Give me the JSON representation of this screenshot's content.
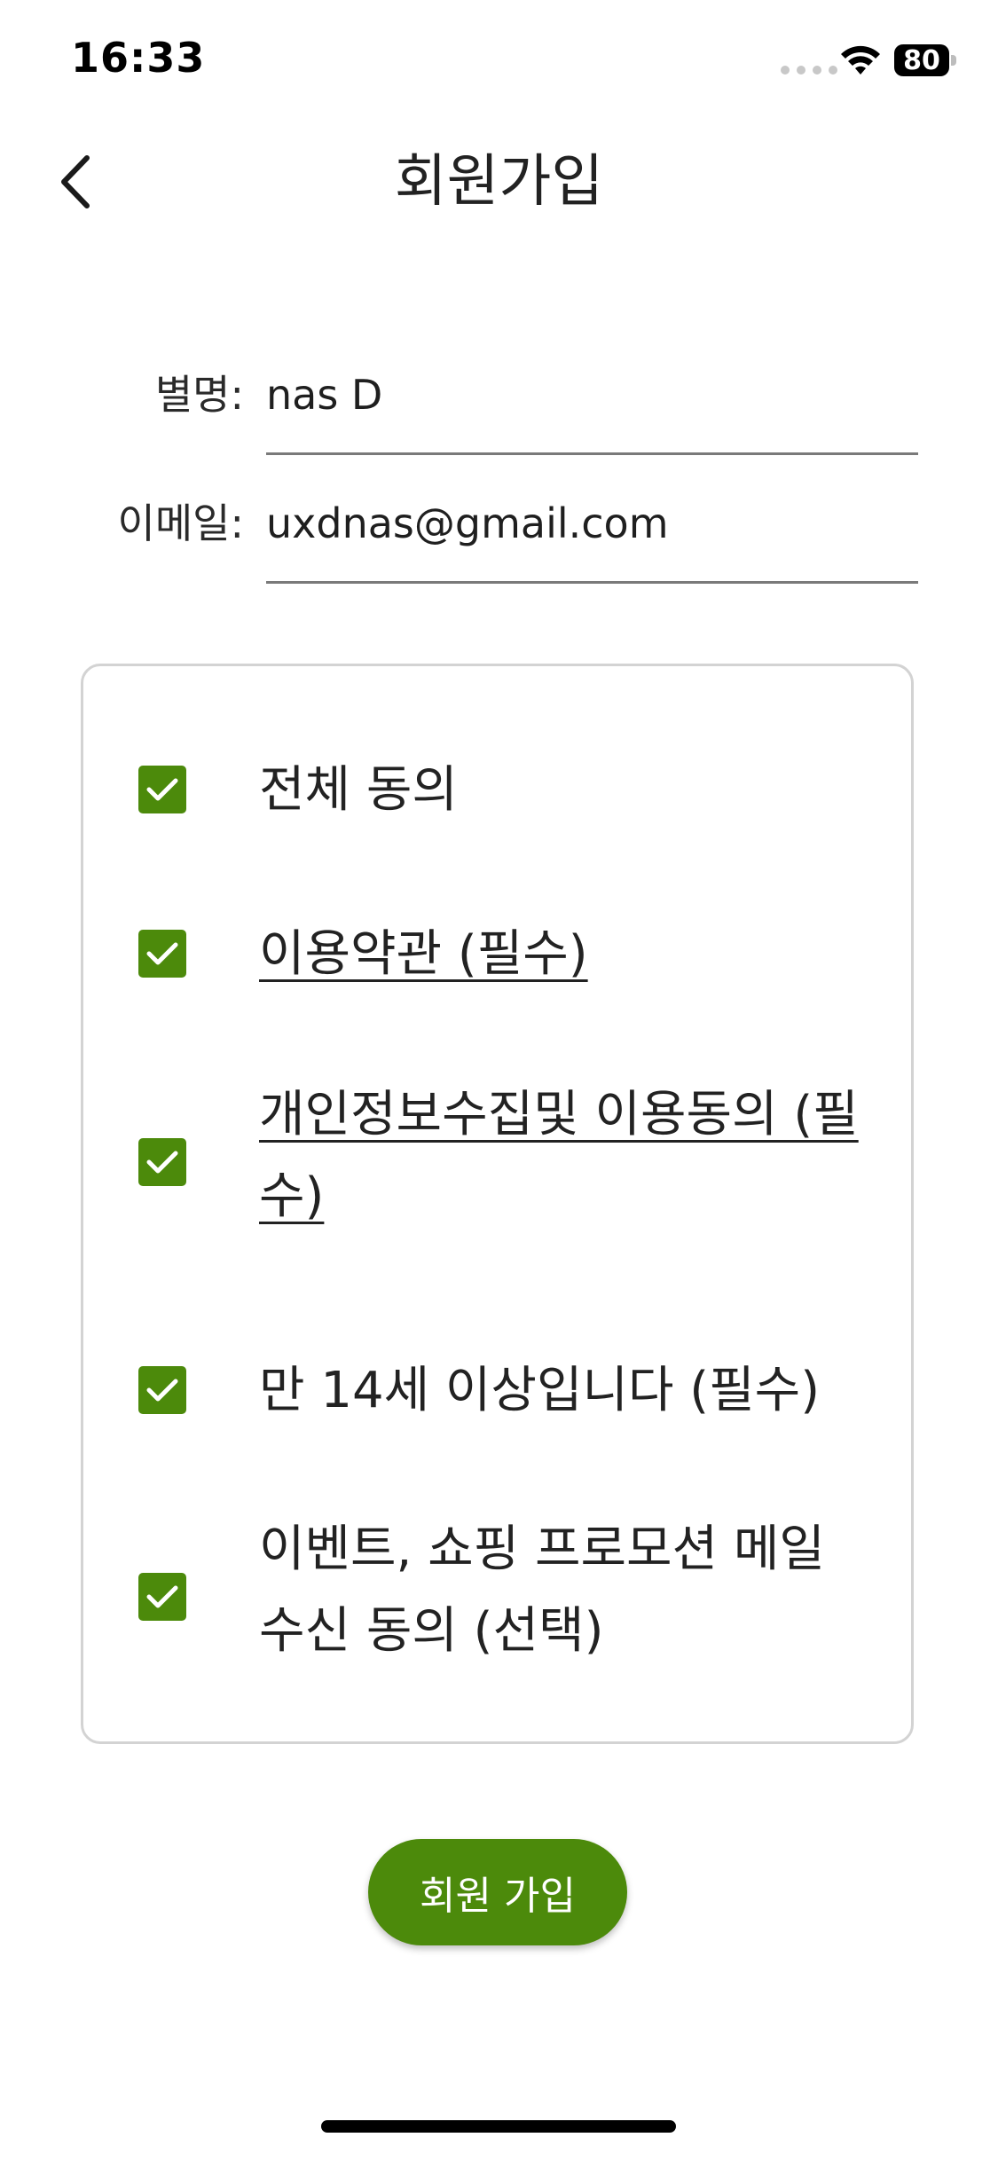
{
  "status_bar": {
    "time": "16:33",
    "battery": "80",
    "icons": [
      "cellular-signal-icon",
      "wifi-icon",
      "battery-icon"
    ]
  },
  "nav": {
    "title": "회원가입",
    "back_icon": "chevron-left-icon"
  },
  "form": {
    "nickname": {
      "label": "별명:",
      "value": "nas D"
    },
    "email": {
      "label": "이메일:",
      "value": "uxdnas@gmail.com"
    }
  },
  "agreements": [
    {
      "label": "전체 동의",
      "checked": true,
      "link": false
    },
    {
      "label": "이용약관 (필수)",
      "checked": true,
      "link": true
    },
    {
      "label": "개인정보수집및 이용동의 (필수)",
      "checked": true,
      "link": true
    },
    {
      "label": "만 14세 이상입니다 (필수)",
      "checked": true,
      "link": false
    },
    {
      "label": "이벤트, 쇼핑 프로모션 메일 수신 동의 (선택)",
      "checked": true,
      "link": false
    }
  ],
  "submit": {
    "label": "회원 가입"
  },
  "colors": {
    "accent": "#4c8a0b",
    "text": "#222222",
    "border": "#d3d3d3"
  }
}
